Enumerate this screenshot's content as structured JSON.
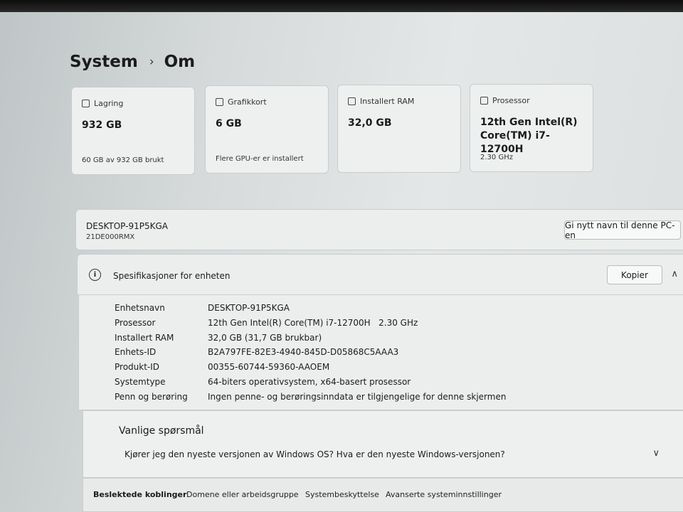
{
  "breadcrumb": {
    "parent": "System",
    "current": "Om"
  },
  "cards": [
    {
      "title": "Lagring",
      "value": "932 GB",
      "footer": "60 GB av 932 GB brukt"
    },
    {
      "title": "Grafikkort",
      "value": "6 GB",
      "footer": "Flere GPU-er er installert"
    },
    {
      "title": "Installert RAM",
      "value": "32,0 GB",
      "footer": ""
    },
    {
      "title": "Prosessor",
      "value": "12th Gen Intel(R) Core(TM) i7-12700H",
      "footer": "2.30 GHz"
    }
  ],
  "device": {
    "name": "DESKTOP-91P5KGA",
    "model": "21DE000RMX",
    "rename_label": "Gi nytt navn til denne PC-en"
  },
  "specs": {
    "title": "Spesifikasjoner for enheten",
    "copy_label": "Kopier",
    "rows": [
      {
        "key": "Enhetsnavn",
        "value": "DESKTOP-91P5KGA"
      },
      {
        "key": "Prosessor",
        "value": "12th Gen Intel(R) Core(TM) i7-12700H   2.30 GHz"
      },
      {
        "key": "Installert RAM",
        "value": "32,0 GB (31,7 GB brukbar)"
      },
      {
        "key": "Enhets-ID",
        "value": "B2A797FE-82E3-4940-845D-D05868C5AAA3"
      },
      {
        "key": "Produkt-ID",
        "value": "00355-60744-59360-AAOEM"
      },
      {
        "key": "Systemtype",
        "value": "64-biters operativsystem, x64-basert prosessor"
      },
      {
        "key": "Penn og berøring",
        "value": "Ingen penne- og berøringsinndata er tilgjengelige for denne skjermen"
      }
    ]
  },
  "faq": {
    "heading": "Vanlige spørsmål",
    "question": "Kjører jeg den nyeste versjonen av Windows OS? Hva er den nyeste Windows-versjonen?"
  },
  "related": {
    "label": "Beslektede koblinger",
    "links": [
      "Domene eller arbeidsgruppe",
      "Systembeskyttelse",
      "Avanserte systeminnstillinger"
    ]
  },
  "icons": {
    "storage": "storage-icon",
    "gpu": "gpu-icon",
    "ram": "ram-icon",
    "cpu": "cpu-icon",
    "info": "info-icon",
    "chevron_up": "chevron-up-icon",
    "chevron_down": "chevron-down-icon"
  }
}
